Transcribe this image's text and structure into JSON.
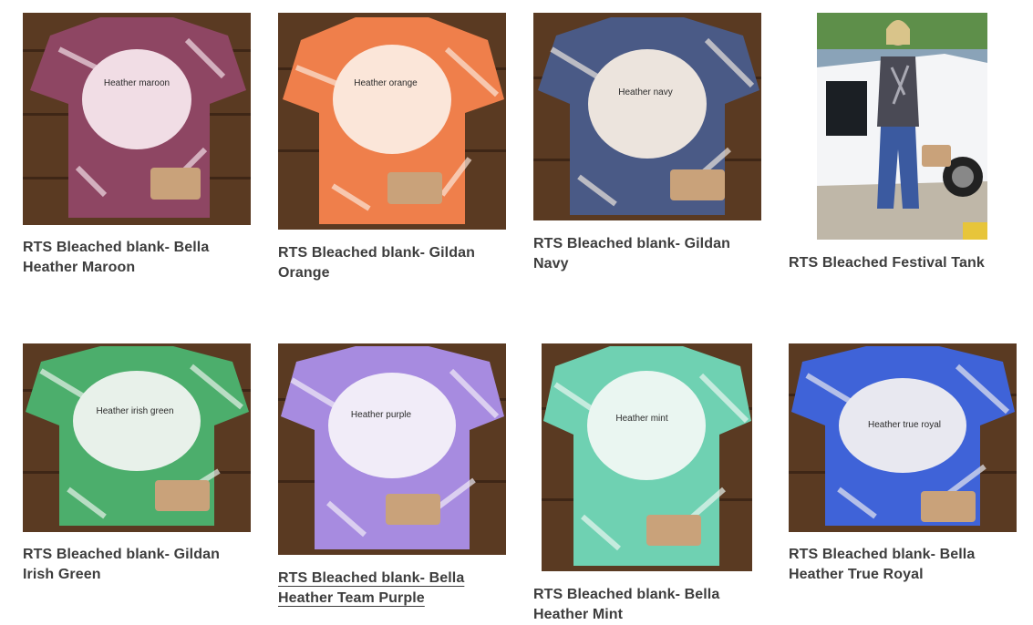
{
  "products": [
    {
      "title": "RTS Bleached blank- Bella Heather Maroon",
      "shirt_text": "Heather maroon",
      "shirt_color": "#8e4663",
      "bleach_color": "#f1dde5"
    },
    {
      "title": "RTS Bleached blank- Gildan Orange",
      "shirt_text": "Heather orange",
      "shirt_color": "#ef7f4b",
      "bleach_color": "#fbe6d9"
    },
    {
      "title": "RTS Bleached blank- Gildan Navy",
      "shirt_text": "Heather navy",
      "shirt_color": "#4a5a86",
      "bleach_color": "#ece4dd"
    },
    {
      "title": "RTS Bleached Festival Tank",
      "shirt_text": "",
      "shirt_color": "#4a4a55",
      "bleach_color": "#d8d8dc"
    },
    {
      "title": "RTS Bleached blank- Gildan Irish Green",
      "shirt_text": "Heather irish green",
      "shirt_color": "#4cae6c",
      "bleach_color": "#e8f1ea"
    },
    {
      "title": "RTS Bleached blank- Bella Heather Team Purple",
      "shirt_text": "Heather purple",
      "shirt_color": "#a78be0",
      "bleach_color": "#f1ecf8"
    },
    {
      "title": "RTS Bleached blank- Bella Heather Mint",
      "shirt_text": "Heather mint",
      "shirt_color": "#6fd1b2",
      "bleach_color": "#eaf6f1"
    },
    {
      "title": "RTS Bleached blank- Bella Heather True Royal",
      "shirt_text": "Heather true royal",
      "shirt_color": "#3f63d8",
      "bleach_color": "#e8e8f0"
    }
  ],
  "colors": {
    "wood": "#5a3a22",
    "wood_dark": "#3e2616",
    "title_text": "#3d3d3d"
  }
}
